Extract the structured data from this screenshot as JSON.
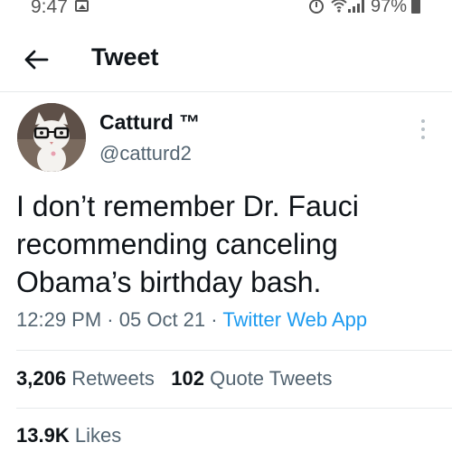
{
  "status_bar": {
    "time": "9:47",
    "battery": "97%",
    "icons": [
      "gallery-icon",
      "alarm-icon",
      "wifi-icon",
      "signal-icon",
      "battery-icon"
    ]
  },
  "header": {
    "back_icon": "arrow-left-icon",
    "title": "Tweet"
  },
  "author": {
    "display_name": "Catturd ™",
    "username": "@catturd2"
  },
  "tweet": {
    "lines": [
      "I don’t remember Dr. Fauci",
      "recommending canceling",
      "Obama’s birthday bash."
    ],
    "time": "12:29 PM",
    "separator": "·",
    "date": "05 Oct 21",
    "source": "Twitter Web App"
  },
  "stats": {
    "retweets_count": "3,206",
    "retweets_label": "Retweets",
    "quotes_count": "102",
    "quotes_label": "Quote Tweets",
    "likes_count": "13.9K",
    "likes_label": "Likes"
  },
  "colors": {
    "link": "#1d9bf0",
    "secondary_text": "#536471",
    "primary_text": "#0f1419",
    "divider": "#e6e9eb"
  }
}
